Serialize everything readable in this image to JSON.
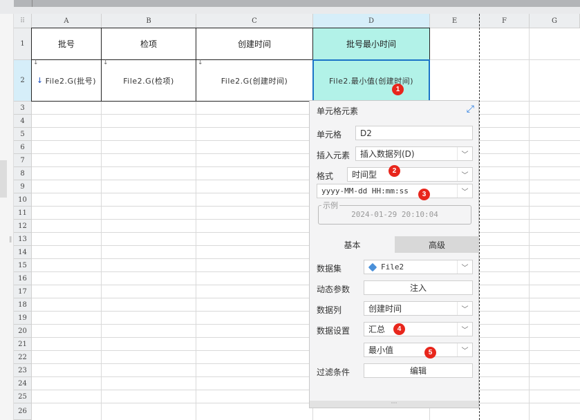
{
  "corner_glyph": "⠿",
  "columns": [
    "A",
    "B",
    "C",
    "D",
    "E",
    "F",
    "G"
  ],
  "rows": [
    "1",
    "2",
    "3",
    "4",
    "5",
    "6",
    "7",
    "8",
    "9",
    "10",
    "11",
    "12",
    "13",
    "14",
    "15",
    "16",
    "17",
    "18",
    "19",
    "20",
    "21",
    "22",
    "23",
    "24",
    "25",
    "26"
  ],
  "header_row": {
    "a1": "批号",
    "b1": "检项",
    "c1": "创建时间",
    "d1": "批号最小时间"
  },
  "data_row": {
    "a2": "File2.G(批号)",
    "b2": "File2.G(检项)",
    "c2": "File2.G(创建时间)",
    "d2": "File2.最小值(创建时间)"
  },
  "expand_marker": "↓",
  "badges": [
    "1",
    "2",
    "3",
    "4",
    "5"
  ],
  "panel": {
    "title": "单元格元素",
    "expand_icon": "⤢",
    "cell_label": "单元格",
    "cell_value": "D2",
    "insert_label": "插入元素",
    "insert_value": "插入数据列(D)",
    "format_label": "格式",
    "format_value": "时间型",
    "pattern_value": "yyyy-MM-dd HH:mm:ss",
    "example_legend": "示例",
    "example_value": "2024-01-29 20:10:04",
    "tab_basic": "基本",
    "tab_advanced": "高级",
    "dataset_label": "数据集",
    "dataset_value": "File2",
    "dynparam_label": "动态参数",
    "dynparam_button": "注入",
    "column_label": "数据列",
    "column_value": "创建时间",
    "setting_label": "数据设置",
    "setting_value": "汇总",
    "agg_value": "最小值",
    "filter_label": "过滤条件",
    "filter_button": "编辑",
    "grip": "⋯"
  },
  "colors": {
    "accent": "#1a73c7",
    "selected_fill": "#b2f2e8",
    "badge": "#e8261c"
  }
}
